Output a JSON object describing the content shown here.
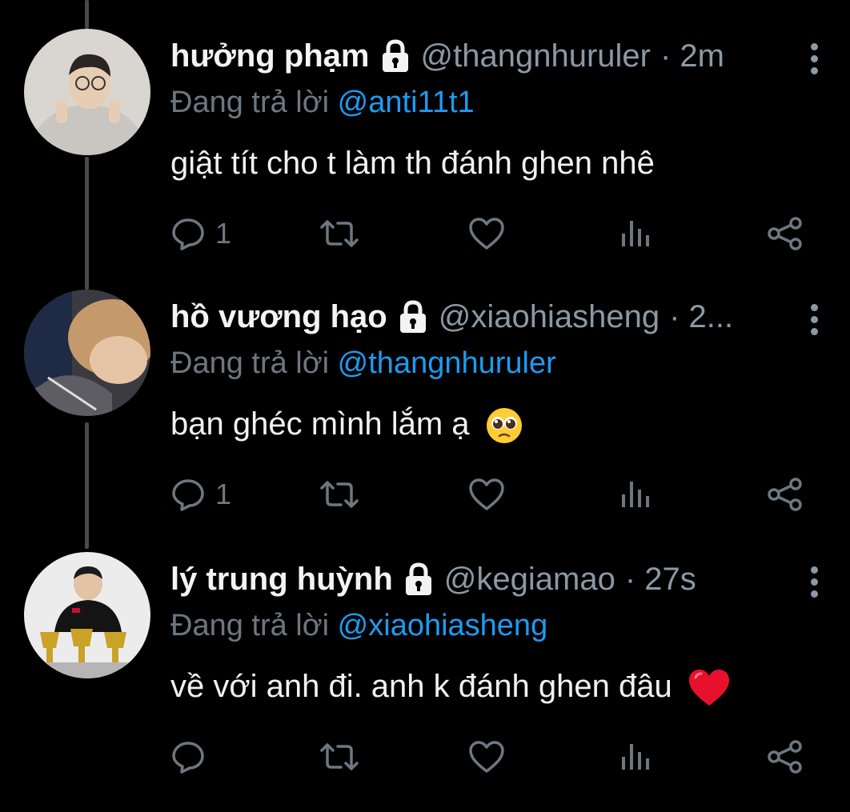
{
  "tweets": [
    {
      "name": "hưởng phạm",
      "handle": "@thangnhuruler",
      "time": "· 2m",
      "reply_prefix": "Đang trả lời",
      "reply_to": "@anti11t1",
      "text": "giật tít cho t làm th đánh ghen nhê",
      "emoji": "",
      "reply_count": "1",
      "avatar_icon": "avatar-boy-hoodie"
    },
    {
      "name": "hồ vương hạo",
      "handle": "@xiaohiasheng",
      "time": "· 2...",
      "reply_prefix": "Đang trả lời",
      "reply_to": "@thangnhuruler",
      "text": "bạn ghéc mình lắm ạ",
      "emoji": "pleading-face-emoji",
      "reply_count": "1",
      "avatar_icon": "avatar-hug"
    },
    {
      "name": "lý trung huỳnh",
      "handle": "@kegiamao",
      "time": "· 27s",
      "reply_prefix": "Đang trả lời",
      "reply_to": "@xiaohiasheng",
      "text": "về với anh đi. anh k đánh ghen đâu",
      "emoji": "red-heart-emoji",
      "reply_count": "",
      "avatar_icon": "avatar-trophies"
    }
  ],
  "colors": {
    "background": "#000000",
    "text": "#e7e9ea",
    "secondary": "#8b98a5",
    "link": "#1d9bf0",
    "thread_line": "#4a4a4a"
  },
  "icons": [
    "reply-icon",
    "retweet-icon",
    "like-icon",
    "views-icon",
    "share-icon",
    "lock-icon",
    "more-options-icon"
  ]
}
